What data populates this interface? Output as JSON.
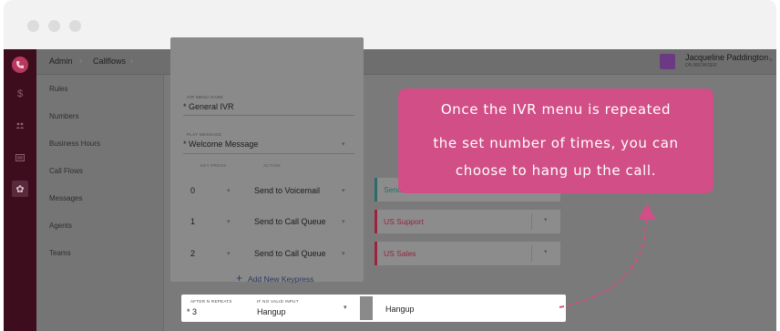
{
  "app": {
    "breadcrumb": [
      "Admin",
      "Callflows"
    ],
    "user": {
      "name": "Jacqueline Paddington",
      "status": "ON BROWSER"
    }
  },
  "rail": {
    "icons": [
      "phone-logo-icon",
      "dollar-icon",
      "users-icon",
      "list-icon",
      "gear-icon"
    ]
  },
  "sidebar": {
    "items": [
      "Rules",
      "Numbers",
      "Business Hours",
      "Call Flows",
      "Messages",
      "Agents",
      "Teams"
    ]
  },
  "form": {
    "ivr_menu_name": {
      "label": "IVR MENU NAME",
      "value": "* General IVR"
    },
    "play_message": {
      "label": "PLAY MESSAGE",
      "value": "* Welcome Message"
    },
    "columns": {
      "key_press": "KEY PRESS",
      "action": "ACTION"
    },
    "rows": [
      {
        "key": "0",
        "action": "Send to Voicemail",
        "destination": "Send to Voicemail"
      },
      {
        "key": "1",
        "action": "Send to Call Queue",
        "destination": "US Support"
      },
      {
        "key": "2",
        "action": "Send to Call Queue",
        "destination": "US Sales"
      }
    ],
    "add_keypress": "Add New Keypress",
    "after_repeats": {
      "label": "AFTER N REPEATS",
      "value": "* 3"
    },
    "no_valid_input": {
      "label": "IF NO VALID INPUT",
      "value": "Hangup"
    },
    "hangup_destination": "Hangup"
  },
  "callout": {
    "lines": [
      "Once the IVR menu is repeated",
      "the set number of times, you can",
      "choose to hang up the call."
    ]
  },
  "colors": {
    "accent": "#d14f86",
    "rail": "#3d0d1e",
    "destination_red": "#9a2440",
    "destination_teal": "#2d6b6b"
  }
}
